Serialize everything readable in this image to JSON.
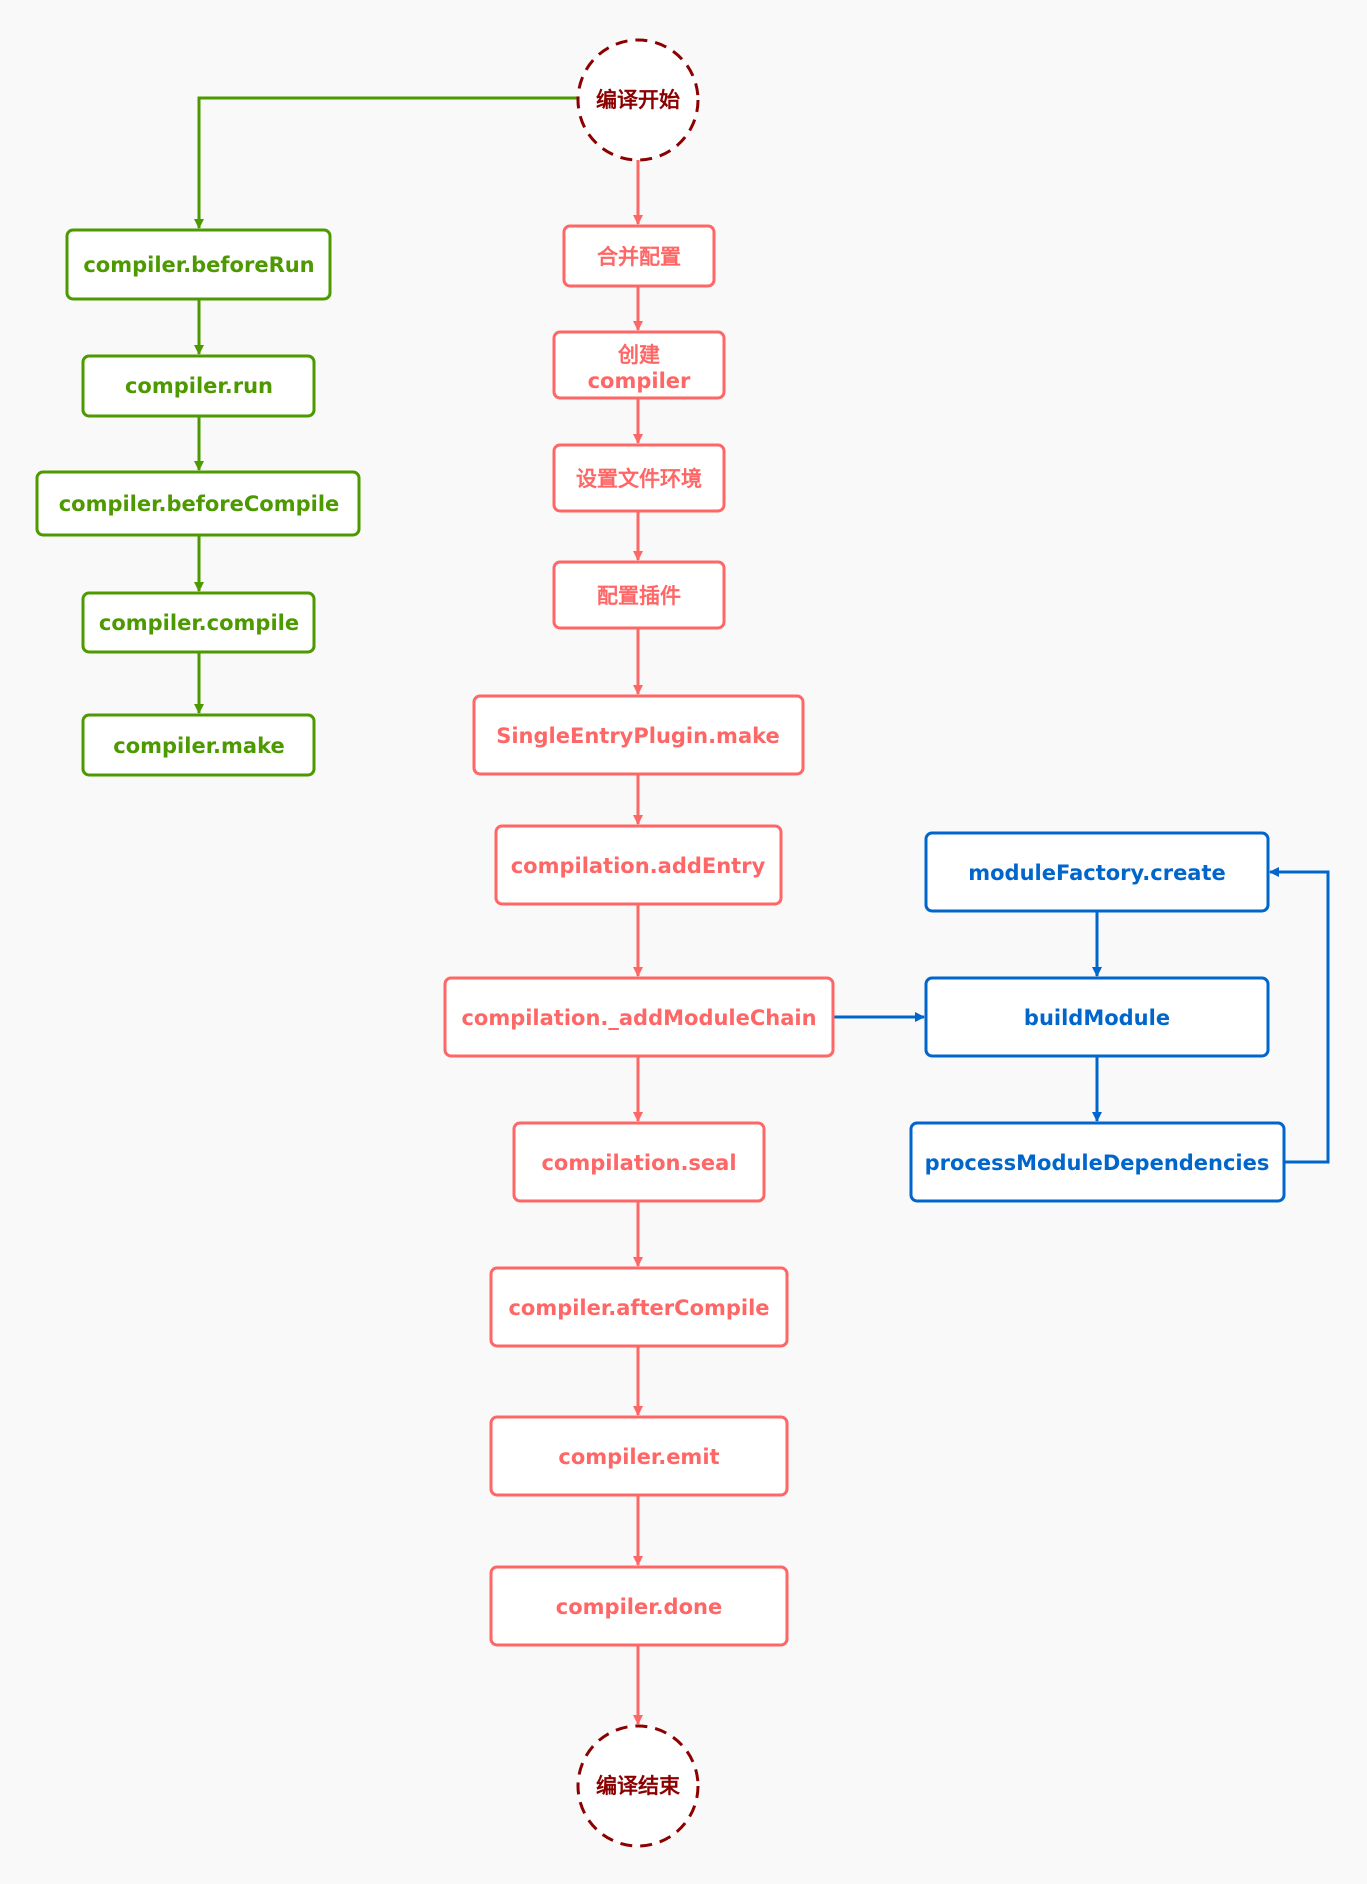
{
  "colors": {
    "background": "#f9f9f9",
    "main": "#ff6666",
    "side": "#4d9900",
    "module": "#0066cc",
    "terminal": "#8b0000",
    "node_fill": "#ffffff"
  },
  "terminals": {
    "start": {
      "id": "start",
      "label": "编译开始"
    },
    "end": {
      "id": "end",
      "label": "编译结束"
    }
  },
  "main_flow": [
    {
      "id": "merge-config",
      "label": "合并配置"
    },
    {
      "id": "create-compiler",
      "label": "创建",
      "label2": "compiler"
    },
    {
      "id": "set-file-env",
      "label": "设置文件环境"
    },
    {
      "id": "config-plugins",
      "label": "配置插件"
    },
    {
      "id": "single-entry-make",
      "label": "SingleEntryPlugin.make"
    },
    {
      "id": "add-entry",
      "label": "compilation.addEntry"
    },
    {
      "id": "add-module-chain",
      "label": "compilation._addModuleChain"
    },
    {
      "id": "seal",
      "label": "compilation.seal"
    },
    {
      "id": "after-compile",
      "label": "compiler.afterCompile"
    },
    {
      "id": "emit",
      "label": "compiler.emit"
    },
    {
      "id": "done",
      "label": "compiler.done"
    }
  ],
  "hooks_flow": [
    {
      "id": "before-run",
      "label": "compiler.beforeRun"
    },
    {
      "id": "run",
      "label": "compiler.run"
    },
    {
      "id": "before-compile",
      "label": "compiler.beforeCompile"
    },
    {
      "id": "compile",
      "label": "compiler.compile"
    },
    {
      "id": "make",
      "label": "compiler.make"
    }
  ],
  "module_flow": [
    {
      "id": "module-factory-create",
      "label": "moduleFactory.create"
    },
    {
      "id": "build-module",
      "label": "buildModule"
    },
    {
      "id": "process-module-deps",
      "label": "processModuleDependencies"
    }
  ],
  "edges": [
    {
      "from": "start",
      "to": "before-run",
      "color": "side"
    },
    {
      "from": "before-run",
      "to": "run",
      "color": "side"
    },
    {
      "from": "run",
      "to": "before-compile",
      "color": "side"
    },
    {
      "from": "before-compile",
      "to": "compile",
      "color": "side"
    },
    {
      "from": "compile",
      "to": "make",
      "color": "side"
    },
    {
      "from": "start",
      "to": "merge-config",
      "color": "main"
    },
    {
      "from": "merge-config",
      "to": "create-compiler",
      "color": "main"
    },
    {
      "from": "create-compiler",
      "to": "set-file-env",
      "color": "main"
    },
    {
      "from": "set-file-env",
      "to": "config-plugins",
      "color": "main"
    },
    {
      "from": "config-plugins",
      "to": "single-entry-make",
      "color": "main"
    },
    {
      "from": "single-entry-make",
      "to": "add-entry",
      "color": "main"
    },
    {
      "from": "add-entry",
      "to": "add-module-chain",
      "color": "main"
    },
    {
      "from": "add-module-chain",
      "to": "seal",
      "color": "main"
    },
    {
      "from": "seal",
      "to": "after-compile",
      "color": "main"
    },
    {
      "from": "after-compile",
      "to": "emit",
      "color": "main"
    },
    {
      "from": "emit",
      "to": "done",
      "color": "main"
    },
    {
      "from": "done",
      "to": "end",
      "color": "main"
    },
    {
      "from": "add-module-chain",
      "to": "build-module",
      "color": "module"
    },
    {
      "from": "module-factory-create",
      "to": "build-module",
      "color": "module"
    },
    {
      "from": "build-module",
      "to": "process-module-deps",
      "color": "module"
    },
    {
      "from": "process-module-deps",
      "to": "module-factory-create",
      "color": "module"
    }
  ]
}
